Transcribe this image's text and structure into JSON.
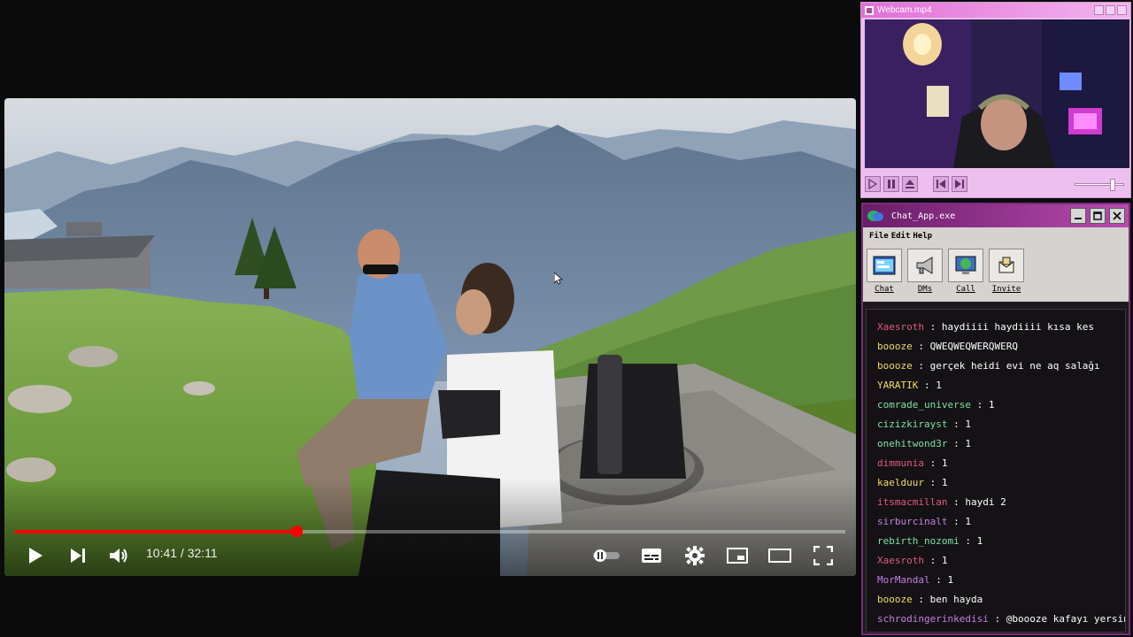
{
  "player": {
    "time_current": "10:41",
    "time_total": "32:11",
    "time_display": "10:41 / 32:11",
    "progress_fraction": 0.3386,
    "accent": "#ff0000"
  },
  "webcam": {
    "title": "Webcam.mp4",
    "volume_fraction": 0.78
  },
  "chat": {
    "title": "Chat_App.exe",
    "menu": [
      "File",
      "Edit",
      "Help"
    ],
    "tools": [
      {
        "label": "Chat",
        "icon": "chat-window-icon"
      },
      {
        "label": "DMs",
        "icon": "megaphone-icon"
      },
      {
        "label": "Call",
        "icon": "globe-monitor-icon"
      },
      {
        "label": "Invite",
        "icon": "envelope-icon"
      }
    ],
    "messages": [
      {
        "user": "Xaesroth",
        "color": "#e15a7e",
        "text": "haydiiii haydiiii kısa kes"
      },
      {
        "user": "boooze",
        "color": "#f2dc5d",
        "text": "QWEQWEQWERQWERQ"
      },
      {
        "user": "boooze",
        "color": "#f2dc5d",
        "text": "gerçek heidi evi ne aq salağı"
      },
      {
        "user": "YARATIK",
        "color": "#f2dc5d",
        "text": "1"
      },
      {
        "user": "comrade_universe",
        "color": "#7ee0a2",
        "text": "1"
      },
      {
        "user": "cizizkirayst",
        "color": "#7ee0a2",
        "text": "1"
      },
      {
        "user": "onehitwond3r",
        "color": "#7ee0a2",
        "text": "1"
      },
      {
        "user": "dimmunia",
        "color": "#e15a7e",
        "text": "1"
      },
      {
        "user": "kaelduur",
        "color": "#f2dc5d",
        "text": "1"
      },
      {
        "user": "itsmacmillan",
        "color": "#e15a7e",
        "text": "haydi 2"
      },
      {
        "user": "sirburcinalt",
        "color": "#c47fe0",
        "text": "1"
      },
      {
        "user": "rebirth_nozomi",
        "color": "#7ee0a2",
        "text": "1"
      },
      {
        "user": "Xaesroth",
        "color": "#e15a7e",
        "text": "1"
      },
      {
        "user": "MorMandal",
        "color": "#c47fe0",
        "text": "1"
      },
      {
        "user": "boooze",
        "color": "#f2dc5d",
        "text": "ben hayda"
      },
      {
        "user": "schrodingerinkedisi",
        "color": "#c47fe0",
        "text": "@boooze kafayı yersin"
      }
    ]
  }
}
